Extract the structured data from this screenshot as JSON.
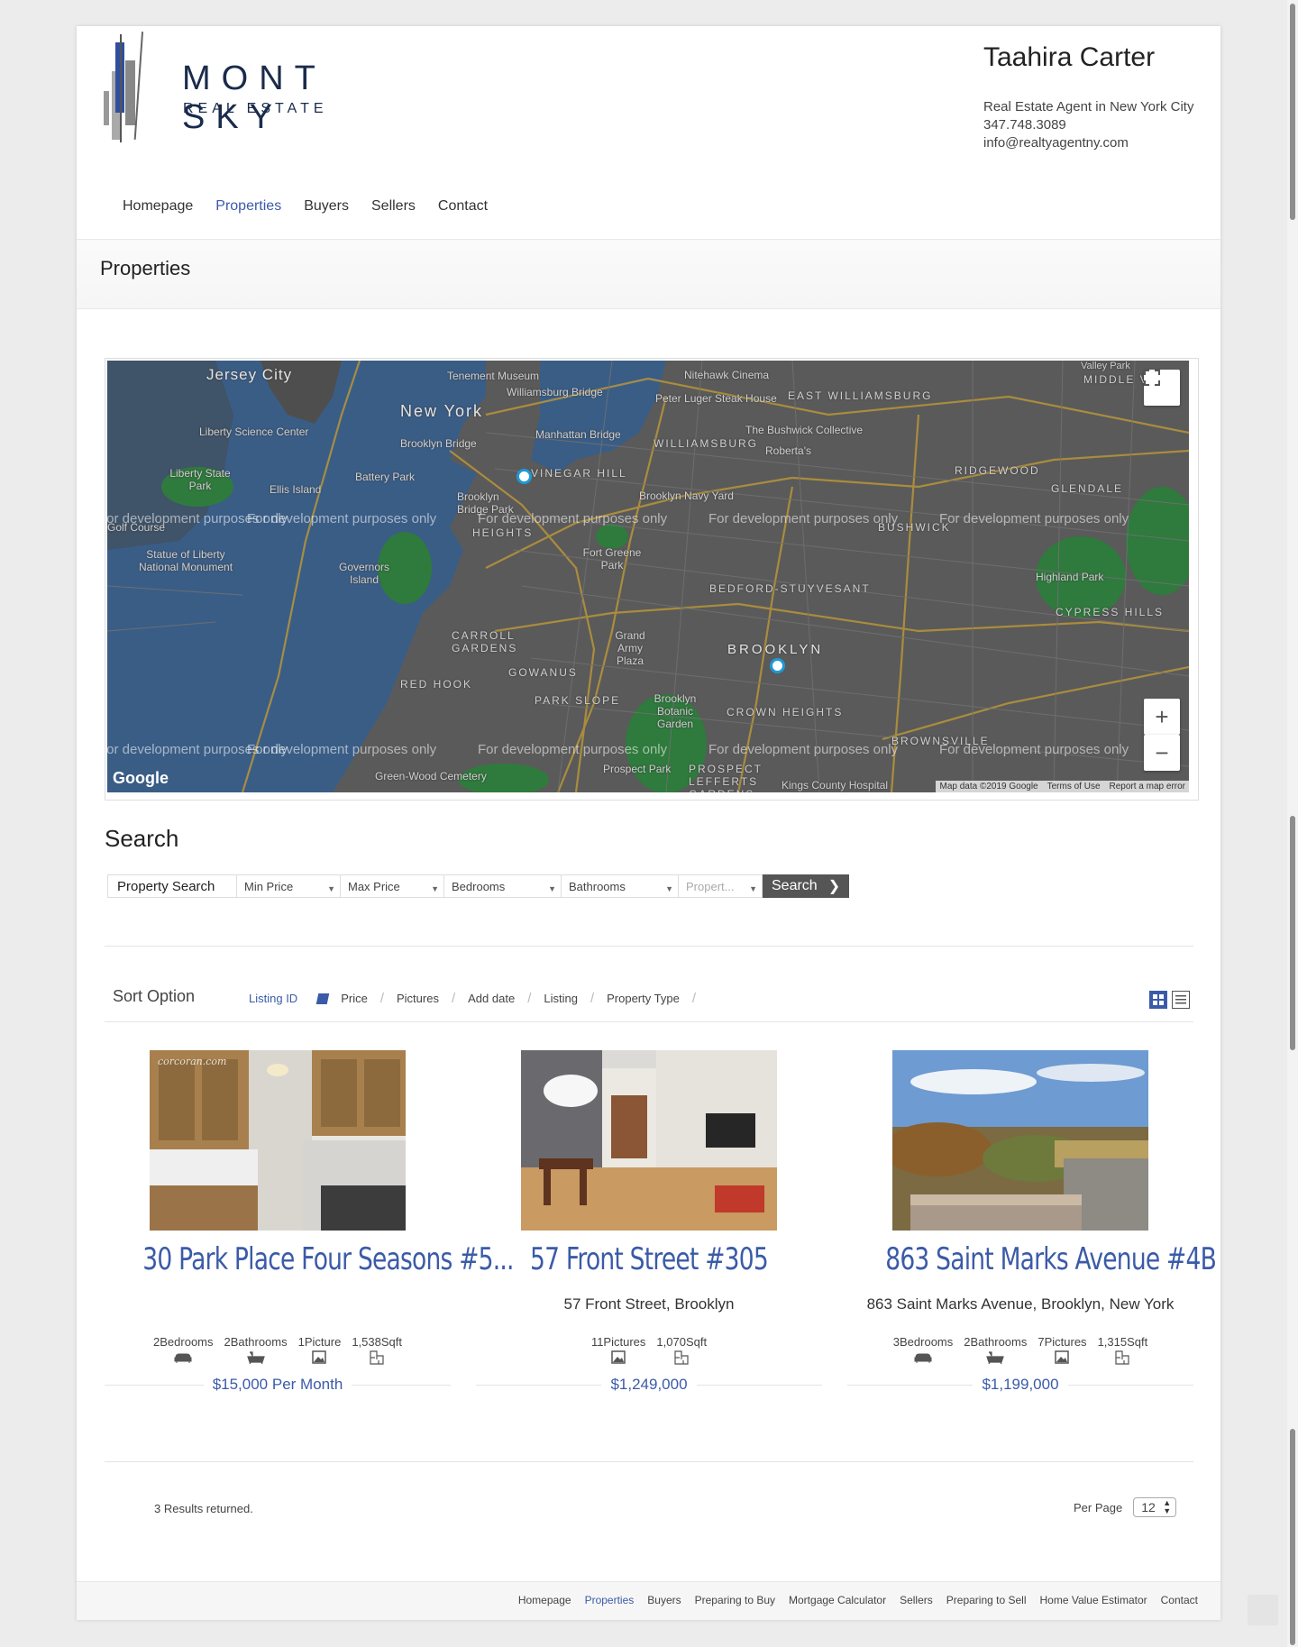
{
  "brand": {
    "name": "MONT SKY",
    "tagline": "REAL ESTATE",
    "colors": {
      "primary": "#1a2b4c",
      "accent": "#3b5ba8",
      "map_water": "#3a5d86"
    }
  },
  "agent": {
    "name": "Taahira Carter",
    "title": "Real Estate Agent in New York City",
    "phone": "347.748.3089",
    "email": "info@realtyagentny.com"
  },
  "nav": {
    "items": [
      "Homepage",
      "Properties",
      "Buyers",
      "Sellers",
      "Contact"
    ],
    "active": "Properties"
  },
  "page_title": "Properties",
  "map": {
    "dev_notice": "For development purposes only",
    "labels": {
      "jersey_city": "Jersey City",
      "new_york": "New York",
      "tenement": "Tenement Museum",
      "williamsburg_bridge": "Williamsburg Bridge",
      "nitehawk": "Nitehawk Cinema",
      "peter_luger": "Peter Luger Steak House",
      "east_williamsburg": "EAST WILLIAMSBURG",
      "williamsburg": "WILLIAMSBURG",
      "manhattan_bridge": "Manhattan Bridge",
      "brooklyn_bridge": "Brooklyn Bridge",
      "bushwick_collective": "The Bushwick Collective",
      "robertas": "Roberta's",
      "liberty_science": "Liberty Science Center",
      "liberty_state_park": "Liberty State Park",
      "ellis_island": "Ellis Island",
      "battery_park": "Battery Park",
      "vinegar_hill": "VINEGAR HILL",
      "navy_yard": "Brooklyn Navy Yard",
      "ridgewood": "RIDGEWOOD",
      "glendale": "GLENDALE",
      "brooklyn_bridge_park": "Brooklyn Bridge Park",
      "heights": "HEIGHTS",
      "bushwick": "BUSHWICK",
      "golf_course": "Golf Course",
      "statue_liberty": "Statue of Liberty National Monument",
      "governors_island": "Governors Island",
      "fort_greene": "Fort Greene Park",
      "bed_stuy": "BEDFORD-STUYVESANT",
      "highland_park": "Highland Park",
      "cypress_hills": "CYPRESS HILLS",
      "carroll_gardens": "CARROLL GARDENS",
      "grand_army": "Grand Army Plaza",
      "brooklyn": "BROOKLYN",
      "gowanus": "GOWANUS",
      "red_hook": "RED HOOK",
      "park_slope": "PARK SLOPE",
      "botanic": "Brooklyn Botanic Garden",
      "crown_heights": "CROWN HEIGHTS",
      "brownsville": "BROWNSVILLE",
      "green_wood": "Green-Wood Cemetery",
      "prospect_park": "Prospect Park",
      "prospect_lefferts": "PROSPECT LEFFERTS GARDENS",
      "kings_county": "Kings County Hospital",
      "valley_park": "Valley Park",
      "middle_v": "MIDDLE V"
    },
    "google": "Google",
    "attribution": [
      "Map data ©2019 Google",
      "Terms of Use",
      "Report a map error"
    ],
    "zoom_in": "+",
    "zoom_out": "−"
  },
  "search": {
    "title": "Search",
    "fields": {
      "property_search": "Property Search",
      "min_price": "Min Price",
      "max_price": "Max Price",
      "bedrooms": "Bedrooms",
      "bathrooms": "Bathrooms",
      "property_type": "Propert..."
    },
    "button": "Search"
  },
  "sort": {
    "label": "Sort Option",
    "options": [
      "Listing ID",
      "Price",
      "Pictures",
      "Add date",
      "Listing",
      "Property Type"
    ],
    "active": "Listing ID"
  },
  "listings": [
    {
      "title": "30 Park Place Four Seasons #5...",
      "address": "",
      "watermark": "corcoran.com",
      "features": [
        {
          "label": "2Bedrooms",
          "icon": "sofa-icon"
        },
        {
          "label": "2Bathrooms",
          "icon": "bathtub-icon"
        },
        {
          "label": "1Picture",
          "icon": "picture-icon"
        },
        {
          "label": "1,538Sqft",
          "icon": "floorplan-icon"
        }
      ],
      "price": "$15,000 Per Month"
    },
    {
      "title": "57 Front Street #305",
      "address": "57 Front Street, Brooklyn",
      "features": [
        {
          "label": "11Pictures",
          "icon": "picture-icon"
        },
        {
          "label": "1,070Sqft",
          "icon": "floorplan-icon"
        }
      ],
      "price": "$1,249,000"
    },
    {
      "title": "863 Saint Marks Avenue #4B",
      "address": "863 Saint Marks Avenue, Brooklyn, New York",
      "features": [
        {
          "label": "3Bedrooms",
          "icon": "sofa-icon"
        },
        {
          "label": "2Bathrooms",
          "icon": "bathtub-icon"
        },
        {
          "label": "7Pictures",
          "icon": "picture-icon"
        },
        {
          "label": "1,315Sqft",
          "icon": "floorplan-icon"
        }
      ],
      "price": "$1,199,000"
    }
  ],
  "results_text": "3 Results returned.",
  "per_page": {
    "label": "Per Page",
    "value": "12"
  },
  "footer": {
    "links": [
      "Homepage",
      "Properties",
      "Buyers",
      "Preparing to Buy",
      "Mortgage Calculator",
      "Sellers",
      "Preparing to Sell",
      "Home Value Estimator",
      "Contact"
    ],
    "active": "Properties"
  }
}
